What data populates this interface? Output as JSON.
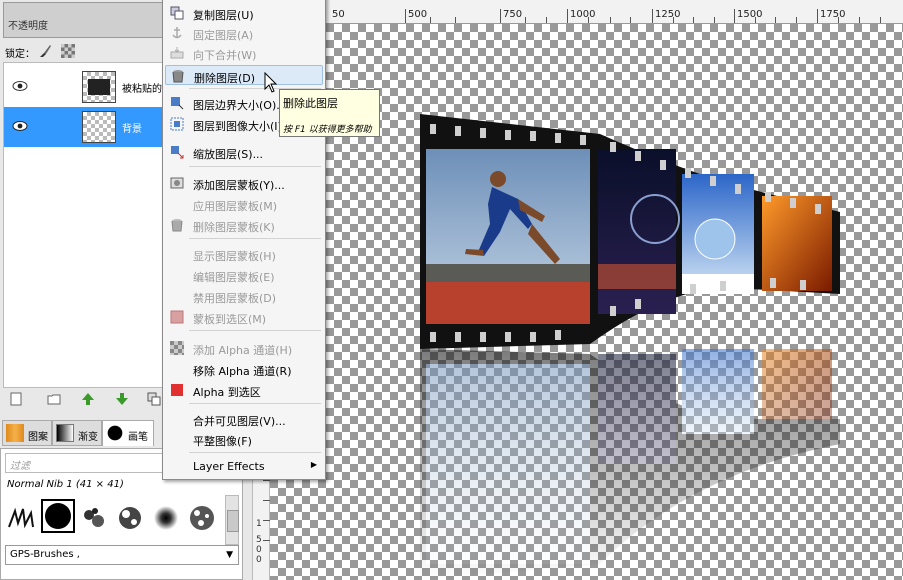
{
  "layers_panel": {
    "opacity_label": "不透明度",
    "lock_label": "锁定：",
    "layers": [
      {
        "name": "被粘贴的",
        "visible": true,
        "selected": false
      },
      {
        "name": "背景",
        "visible": true,
        "selected": true
      }
    ]
  },
  "dock_tabs": [
    {
      "label": "图案",
      "active": false
    },
    {
      "label": "渐变",
      "active": false
    },
    {
      "label": "画笔",
      "active": true
    }
  ],
  "brushes": {
    "filter_placeholder": "过滤",
    "current_brush": "Normal Nib 1 (41 × 41)",
    "tag": "GPS-Brushes ,"
  },
  "ruler": {
    "horizontal_labels": [
      "50",
      "500",
      "750",
      "1000",
      "1250",
      "1500",
      "1750"
    ],
    "vertical_labels": [
      "1",
      "5",
      "0",
      "0"
    ]
  },
  "context_menu": {
    "items": [
      {
        "label": "复制图层(U)",
        "disabled": false,
        "icon": "duplicate-layer-icon"
      },
      {
        "label": "固定图层(A)",
        "disabled": true,
        "icon": "anchor-icon"
      },
      {
        "label": "向下合并(W)",
        "disabled": true,
        "icon": "merge-down-icon"
      },
      {
        "label": "删除图层(D)",
        "disabled": false,
        "icon": "trash-icon",
        "hover": true
      },
      {
        "label": "图层边界大小(O)...",
        "disabled": false,
        "icon": "layer-boundary-icon"
      },
      {
        "label": "图层到图像大小(I)",
        "disabled": false,
        "icon": "layer-to-image-icon"
      },
      {
        "label": "缩放图层(S)...",
        "disabled": false,
        "icon": "scale-layer-icon"
      },
      {
        "label": "添加图层蒙板(Y)...",
        "disabled": false,
        "icon": "add-mask-icon"
      },
      {
        "label": "应用图层蒙板(M)",
        "disabled": true,
        "icon": ""
      },
      {
        "label": "删除图层蒙板(K)",
        "disabled": true,
        "icon": "delete-mask-icon"
      },
      {
        "label": "显示图层蒙板(H)",
        "disabled": true,
        "icon": ""
      },
      {
        "label": "编辑图层蒙板(E)",
        "disabled": true,
        "icon": ""
      },
      {
        "label": "禁用图层蒙板(D)",
        "disabled": true,
        "icon": ""
      },
      {
        "label": "蒙板到选区(M)",
        "disabled": true,
        "icon": "mask-to-selection-icon"
      },
      {
        "label": "添加 Alpha 通道(H)",
        "disabled": true,
        "icon": "add-alpha-icon"
      },
      {
        "label": "移除 Alpha 通道(R)",
        "disabled": false,
        "icon": ""
      },
      {
        "label": "Alpha 到选区",
        "disabled": false,
        "icon": "alpha-to-selection-icon"
      },
      {
        "label": "合并可见图层(V)...",
        "disabled": false,
        "icon": ""
      },
      {
        "label": "平整图像(F)",
        "disabled": false,
        "icon": ""
      },
      {
        "label": "Layer Effects",
        "disabled": false,
        "icon": "",
        "submenu": true
      }
    ]
  },
  "tooltip": {
    "title": "删除此图层",
    "help": "按 F1 以获得更多帮助"
  },
  "colors": {
    "selection": "#3399ff",
    "menu_hover": "#dce9f7",
    "tooltip_bg": "#ffffe1"
  }
}
